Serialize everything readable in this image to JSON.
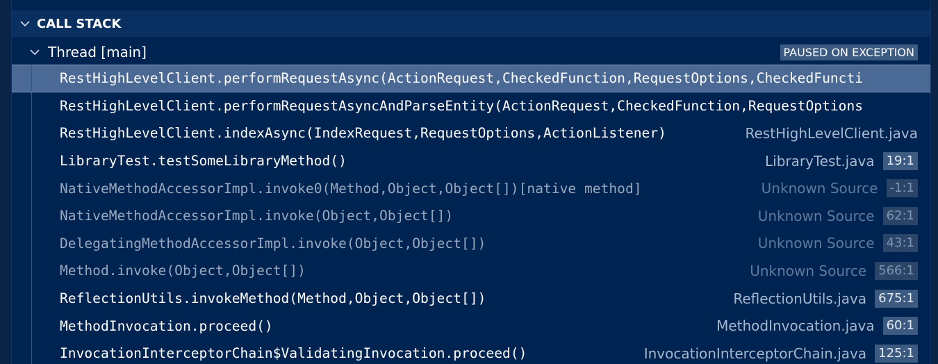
{
  "section": {
    "title": "CALL STACK",
    "chevron_icon": "chevron-down-icon"
  },
  "thread": {
    "label": "Thread [main]",
    "status": "PAUSED ON EXCEPTION",
    "chevron_icon": "chevron-down-icon"
  },
  "colors": {
    "background": "#002451",
    "header": "#0a3062",
    "selected_row": "#4a6a95",
    "badge": "#3c5b82"
  },
  "frames": [
    {
      "name": "RestHighLevelClient.performRequestAsync(ActionRequest,CheckedFunction,RequestOptions,CheckedFuncti",
      "source": "",
      "line": ""
    },
    {
      "name": "RestHighLevelClient.performRequestAsyncAndParseEntity(ActionRequest,CheckedFunction,RequestOptions",
      "source": "",
      "line": ""
    },
    {
      "name": "RestHighLevelClient.indexAsync(IndexRequest,RequestOptions,ActionListener)",
      "source": "RestHighLevelClient.java",
      "line": ""
    },
    {
      "name": "LibraryTest.testSomeLibraryMethod()",
      "source": "LibraryTest.java",
      "line": "19:1"
    },
    {
      "name": "NativeMethodAccessorImpl.invoke0(Method,Object,Object[])[native method]",
      "source": "Unknown Source",
      "line": "-1:1"
    },
    {
      "name": "NativeMethodAccessorImpl.invoke(Object,Object[])",
      "source": "Unknown Source",
      "line": "62:1"
    },
    {
      "name": "DelegatingMethodAccessorImpl.invoke(Object,Object[])",
      "source": "Unknown Source",
      "line": "43:1"
    },
    {
      "name": "Method.invoke(Object,Object[])",
      "source": "Unknown Source",
      "line": "566:1"
    },
    {
      "name": "ReflectionUtils.invokeMethod(Method,Object,Object[])",
      "source": "ReflectionUtils.java",
      "line": "675:1"
    },
    {
      "name": "MethodInvocation.proceed()",
      "source": "MethodInvocation.java",
      "line": "60:1"
    },
    {
      "name": "InvocationInterceptorChain$ValidatingInvocation.proceed()",
      "source": "InvocationInterceptorChain.java",
      "line": "125:1"
    }
  ]
}
